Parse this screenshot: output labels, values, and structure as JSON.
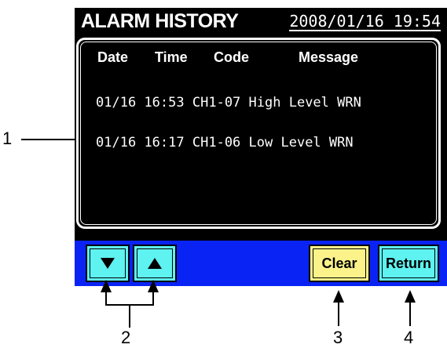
{
  "title_bar": {
    "title": "ALARM HISTORY",
    "datetime": "2008/01/16  19:54"
  },
  "table": {
    "headers": {
      "date": "Date",
      "time": "Time",
      "code": "Code",
      "message": "Message"
    },
    "rows": [
      {
        "date": "01/16",
        "time": "16:53",
        "code": "CH1-07",
        "message": "High Level WRN"
      },
      {
        "date": "01/16",
        "time": "16:17",
        "code": "CH1-06",
        "message": "Low Level WRN"
      }
    ]
  },
  "buttons": {
    "down_icon": "triangle-down-icon",
    "up_icon": "triangle-up-icon",
    "clear_label": "Clear",
    "return_label": "Return"
  },
  "callouts": {
    "c1": "1",
    "c2": "2",
    "c3": "3",
    "c4": "4"
  },
  "colors": {
    "screen_bg": "#000000",
    "button_bar": "#0a23f5",
    "arrow_button": "#5ef2f0",
    "clear_button": "#fbf38a",
    "return_button": "#5ef2f0"
  }
}
